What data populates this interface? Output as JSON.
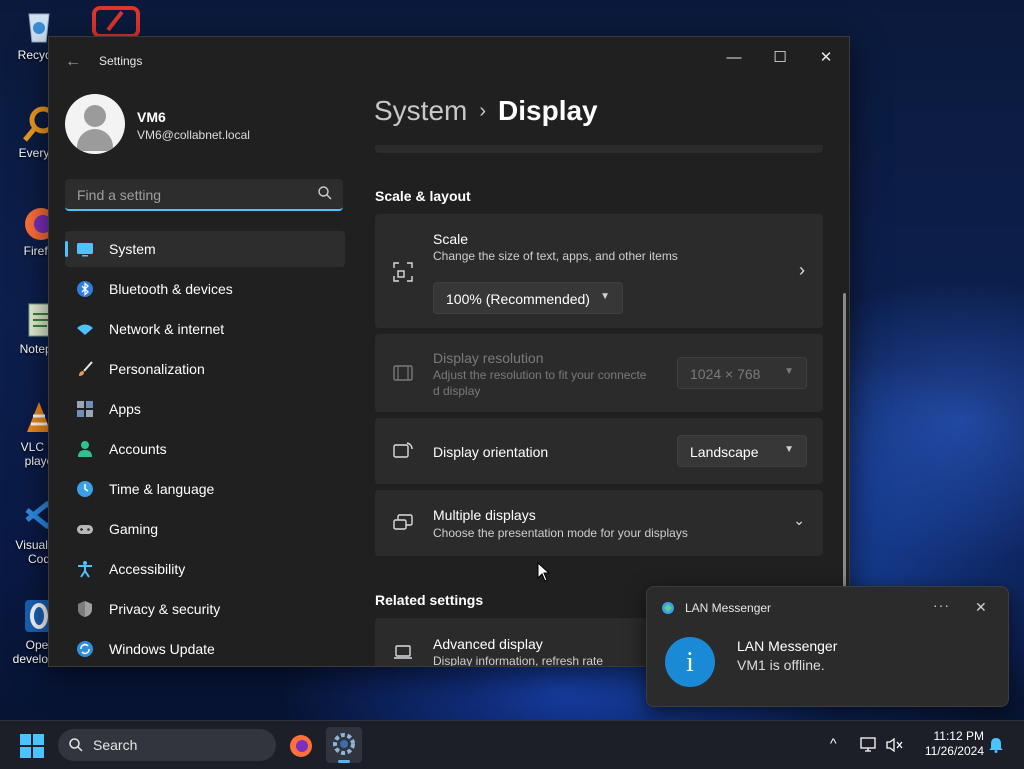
{
  "desktop": {
    "icons": [
      {
        "label": "Recycle",
        "icon": "recycle-bin-icon"
      },
      {
        "label": "Everyth",
        "icon": "everything-search-icon"
      },
      {
        "label": "Firefo",
        "icon": "firefox-icon"
      },
      {
        "label": "Notepa",
        "icon": "notepad-icon"
      },
      {
        "label_line1": "VLC m",
        "label_line2": "playe",
        "icon": "vlc-icon"
      },
      {
        "label_line1": "Visual St",
        "label_line2": "Cod",
        "icon": "vscode-icon"
      },
      {
        "label_line1": "Oper",
        "label_line2": "developer",
        "icon": "opera-icon"
      }
    ]
  },
  "window": {
    "title": "Settings",
    "controls": {
      "minimize": "—",
      "maximize": "☐",
      "close": "✕"
    }
  },
  "profile": {
    "name": "VM6",
    "email": "VM6@collabnet.local"
  },
  "search": {
    "placeholder": "Find a setting"
  },
  "nav": {
    "items": [
      {
        "label": "System",
        "icon": "system-display-icon",
        "color": "#4cc2ff"
      },
      {
        "label": "Bluetooth & devices",
        "icon": "bluetooth-icon",
        "color": "#3b8eea"
      },
      {
        "label": "Network & internet",
        "icon": "wifi-icon",
        "color": "#4cc2ff"
      },
      {
        "label": "Personalization",
        "icon": "brush-icon",
        "color": "#e8a36b"
      },
      {
        "label": "Apps",
        "icon": "apps-icon",
        "color": "#9aa6b8"
      },
      {
        "label": "Accounts",
        "icon": "person-icon",
        "color": "#2fc28f"
      },
      {
        "label": "Time & language",
        "icon": "globe-clock-icon",
        "color": "#4cc2ff"
      },
      {
        "label": "Gaming",
        "icon": "gamepad-icon",
        "color": "#b8b8b8"
      },
      {
        "label": "Accessibility",
        "icon": "accessibility-icon",
        "color": "#4cc2ff"
      },
      {
        "label": "Privacy & security",
        "icon": "shield-icon",
        "color": "#a0a0a0"
      },
      {
        "label": "Windows Update",
        "icon": "update-icon",
        "color": "#4cc2ff"
      }
    ]
  },
  "breadcrumb": {
    "parent": "System",
    "separator": "›",
    "current": "Display"
  },
  "scale_layout": {
    "title": "Scale & layout",
    "scale": {
      "title": "Scale",
      "subtitle": "Change the size of text, apps, and other items",
      "value": "100% (Recommended)"
    },
    "resolution": {
      "title": "Display resolution",
      "subtitle_line1": "Adjust the resolution to fit your connecte",
      "subtitle_line2": "d display",
      "value": "1024 × 768"
    },
    "orientation": {
      "title": "Display orientation",
      "value": "Landscape"
    },
    "multiple": {
      "title": "Multiple displays",
      "subtitle": "Choose the presentation mode for your displays"
    }
  },
  "related": {
    "title": "Related settings",
    "advanced": {
      "title": "Advanced display",
      "subtitle": "Display information, refresh rate"
    }
  },
  "toast": {
    "app_name": "LAN Messenger",
    "more": "···",
    "close": "✕",
    "icon_glyph": "i",
    "title": "LAN Messenger",
    "body": "VM1 is offline."
  },
  "taskbar": {
    "search_label": "Search",
    "caret": "^",
    "time": "11:12 PM",
    "date": "11/26/2024"
  }
}
